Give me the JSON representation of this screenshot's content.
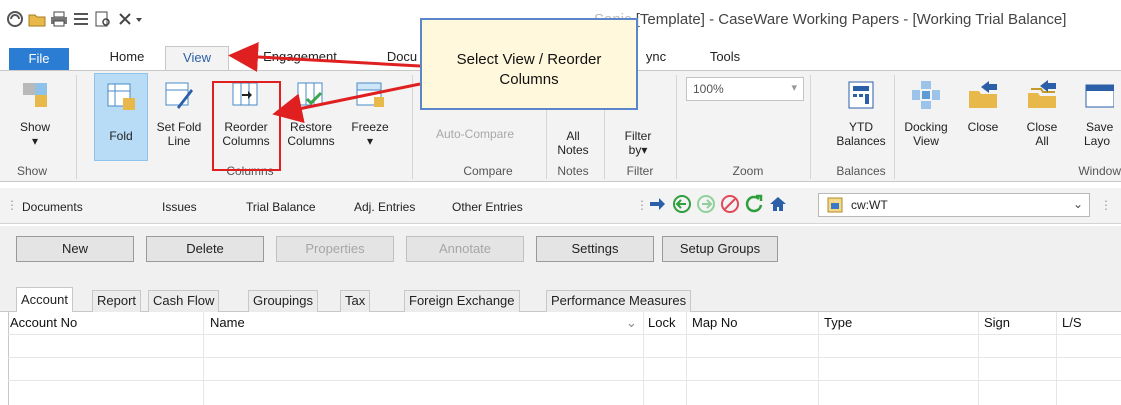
{
  "window": {
    "title": "[Template] - CaseWare Working Papers - [Working Trial Balance]",
    "title_prefix_partial": "Sonic"
  },
  "quick_access": [
    "app-icon",
    "open-folder-icon",
    "print-icon",
    "list-icon",
    "print-preview-icon",
    "close-x-icon",
    "dropdown-arrow-icon"
  ],
  "tabs": {
    "file": "File",
    "home": "Home",
    "view": "View",
    "engagement": "Engagement",
    "documents_partial": "Docu",
    "sync_partial": "ync",
    "tools": "Tools"
  },
  "ribbon": {
    "show": {
      "label": "Show",
      "group": "Show"
    },
    "fold": {
      "label": "Fold"
    },
    "set_fold_line": {
      "line1": "Set Fold",
      "line2": "Line"
    },
    "reorder_columns": {
      "line1": "Reorder",
      "line2": "Columns"
    },
    "restore_columns": {
      "line1": "Restore",
      "line2": "Columns"
    },
    "freeze": {
      "label": "Freeze"
    },
    "columns_group": "Columns",
    "auto_compare": "Auto-Compare",
    "compare_group": "Compare",
    "all_notes": {
      "line1": "All",
      "line2": "Notes"
    },
    "notes_group": "Notes",
    "filter_by": {
      "line1": "Filter",
      "line2": "by"
    },
    "filter_group": "Filter",
    "zoom_value": "100%",
    "zoom_group": "Zoom",
    "ytd_balances": {
      "line1": "YTD",
      "line2": "Balances"
    },
    "balances_group": "Balances",
    "docking_view": {
      "line1": "Docking",
      "line2": "View"
    },
    "close": "Close",
    "close_all": {
      "line1": "Close",
      "line2": "All"
    },
    "save_layout_partial": {
      "line1": "Save",
      "line2": "Layo"
    },
    "window_group_partial": "Window"
  },
  "toolbar": {
    "documents": "Documents",
    "issues": "Issues",
    "trial_balance": "Trial Balance",
    "adj_entries": "Adj. Entries",
    "other_entries": "Other Entries",
    "location": "cw:WT"
  },
  "buttons": {
    "new": "New",
    "delete": "Delete",
    "properties": "Properties",
    "annotate": "Annotate",
    "settings": "Settings",
    "setup_groups": "Setup Groups"
  },
  "subtabs": [
    "Account",
    "Report",
    "Cash Flow",
    "Groupings",
    "Tax",
    "Foreign Exchange",
    "Performance Measures"
  ],
  "grid": {
    "columns": [
      "Account No",
      "Name",
      "Lock",
      "Map No",
      "Type",
      "Sign",
      "L/S"
    ]
  },
  "callout": {
    "line1": "Select View / Reorder",
    "line2": "Columns"
  },
  "colors": {
    "accent_blue": "#2b7cd3",
    "annotation_red": "#e02020",
    "callout_fill": "#fff8dc"
  }
}
